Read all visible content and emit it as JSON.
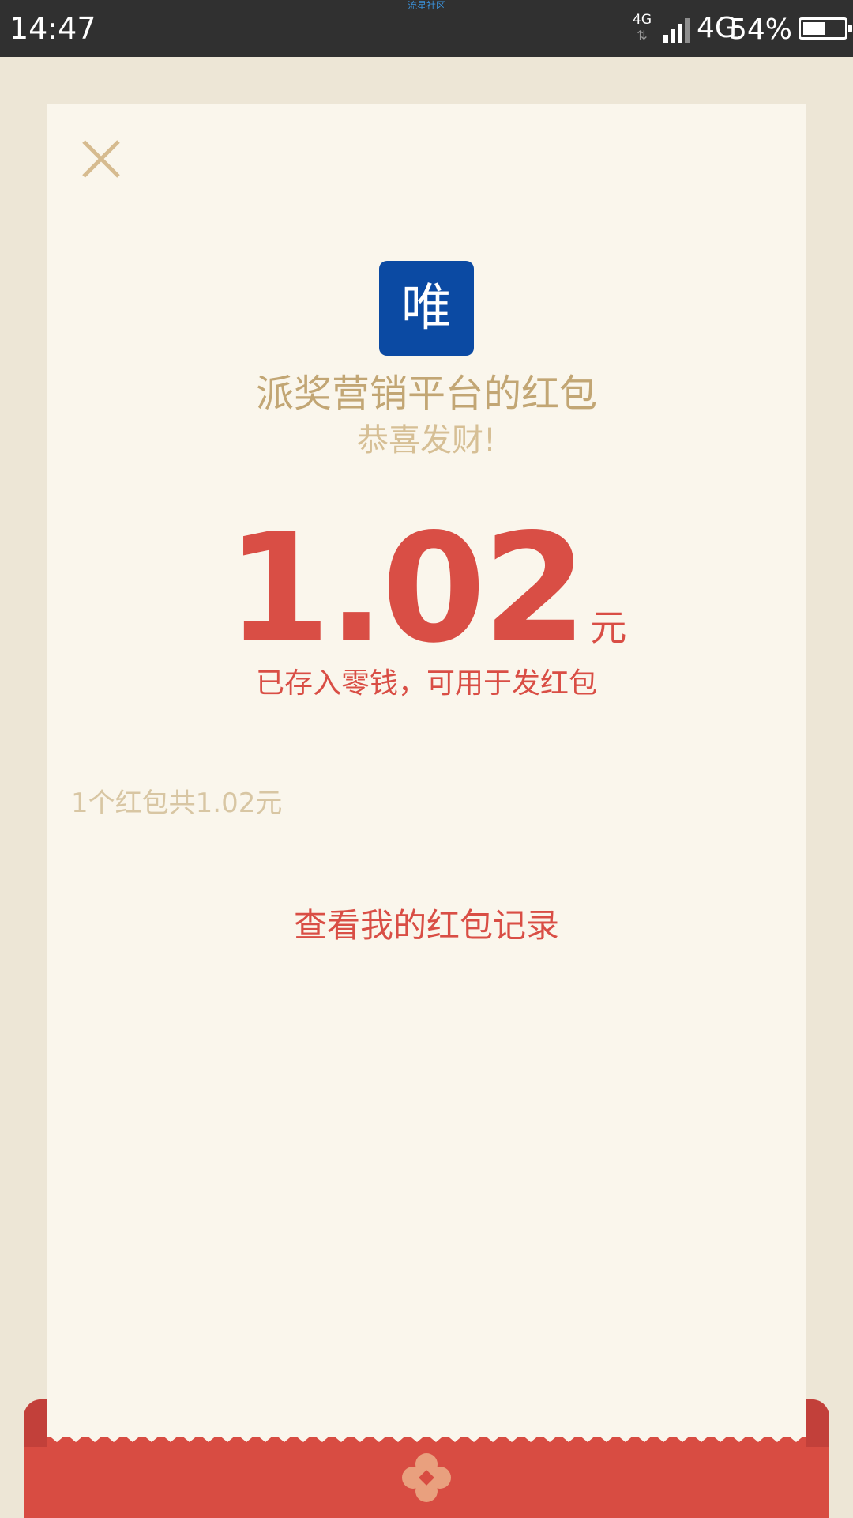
{
  "status_bar": {
    "time": "14:47",
    "notice": "流星社区",
    "network_small": "4G",
    "network_arrows": "⇅",
    "network": "4G",
    "battery": "54%",
    "battery_level": 0.54
  },
  "red_packet": {
    "logo_char": "唯",
    "sender": "派奖营销平台的红包",
    "greeting": "恭喜发财!",
    "amount": "1.02",
    "unit": "元",
    "note": "已存入零钱，可用于发红包",
    "summary": "1个红包共1.02元",
    "records_link": "查看我的红包记录"
  },
  "icons": {
    "close": "close-icon",
    "flower": "flower-icon",
    "signal": "signal-icon",
    "battery": "battery-icon"
  },
  "colors": {
    "status_bar_bg": "#303030",
    "page_bg": "#ede6d6",
    "card_bg": "#faf6ec",
    "accent_red": "#d94e45",
    "gold_text": "#c2a674",
    "light_gold_text": "#d6bf95",
    "logo_blue": "#0b4aa3",
    "envelope_red": "#d84c42"
  }
}
